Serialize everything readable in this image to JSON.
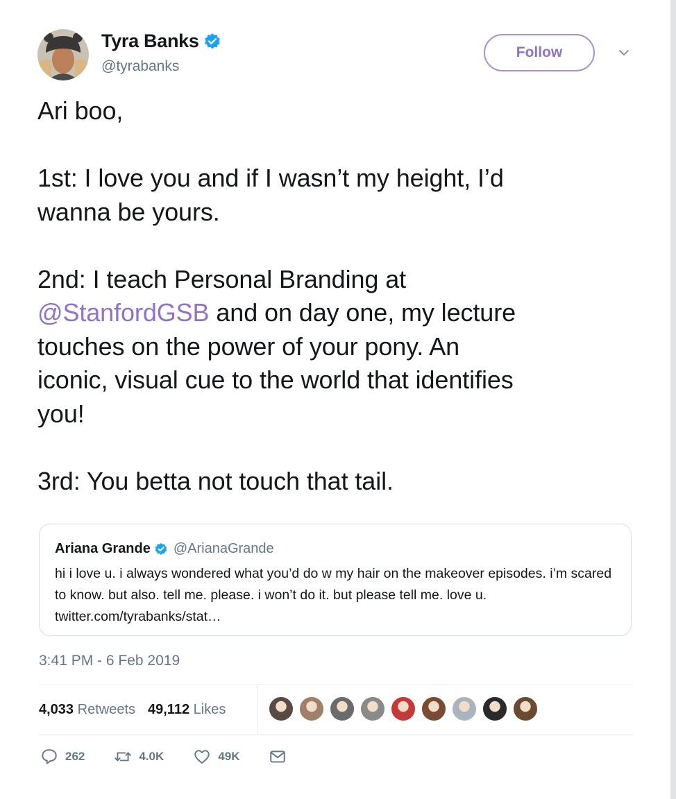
{
  "author": {
    "name": "Tyra Banks",
    "handle": "@tyrabanks",
    "verified": true
  },
  "follow_button": "Follow",
  "tweet": {
    "line1": "Ari boo,",
    "line2": "1st: I love you and if I wasn’t my height, I’d\nwanna be yours.",
    "line3_pre": "2nd: I teach Personal Branding at\n",
    "line3_mention": "@StanfordGSB",
    "line3_post": " and on day one, my lecture\ntouches on the power of your pony. An\niconic, visual cue to the world that identifies\nyou!",
    "line4": "3rd: You betta not touch that tail."
  },
  "quoted_tweet": {
    "name": "Ariana Grande",
    "handle": "@ArianaGrande",
    "verified": true,
    "text": "hi i love u. i always wondered what you’d do w my hair on the makeover episodes. i’m scared to know. but also.  tell me. please. i won’t do it. but please tell me. love u. twitter.com/tyrabanks/stat…"
  },
  "timestamp": "3:41 PM - 6 Feb 2019",
  "stats": {
    "retweets_count": "4,033",
    "retweets_label": "Retweets",
    "likes_count": "49,112",
    "likes_label": "Likes"
  },
  "liker_avatar_colors": [
    "#5a4a44",
    "#a0806a",
    "#6b6b6b",
    "#8a8a8a",
    "#c43a3a",
    "#7b4a34",
    "#aab4be",
    "#2a2a2a",
    "#6a4a30"
  ],
  "actions": {
    "reply_count": "262",
    "retweet_count": "4.0K",
    "like_count": "49K"
  },
  "colors": {
    "accent": "#9073c8",
    "secondary_text": "#657786",
    "verified_blue": "#1da1f2"
  }
}
